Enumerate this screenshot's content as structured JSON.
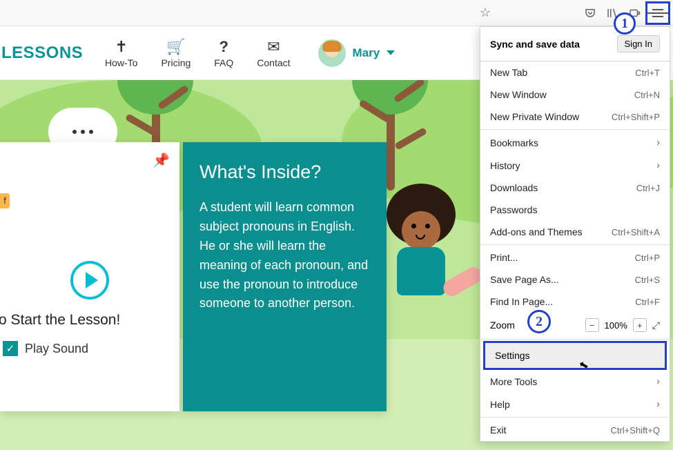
{
  "annotations": {
    "badge1": "1",
    "badge2": "2"
  },
  "nav": {
    "brand": "LESSONS",
    "items": [
      {
        "label": "How-To"
      },
      {
        "label": "Pricing"
      },
      {
        "label": "FAQ"
      },
      {
        "label": "Contact"
      }
    ],
    "user_name": "Mary"
  },
  "lesson": {
    "tag": "f",
    "start": "o Start the Lesson!",
    "sound": "Play Sound",
    "info_title": "What's Inside?",
    "info_text": "A student will learn common subject pronouns in English. He or she will learn the meaning of each pronoun, and use the pronoun to introduce someone to another person."
  },
  "menu": {
    "sync": "Sync and save data",
    "signin": "Sign In",
    "items1": [
      {
        "label": "New Tab",
        "hint": "Ctrl+T"
      },
      {
        "label": "New Window",
        "hint": "Ctrl+N"
      },
      {
        "label": "New Private Window",
        "hint": "Ctrl+Shift+P"
      }
    ],
    "items2": [
      {
        "label": "Bookmarks",
        "chev": true
      },
      {
        "label": "History",
        "chev": true
      },
      {
        "label": "Downloads",
        "hint": "Ctrl+J"
      },
      {
        "label": "Passwords"
      },
      {
        "label": "Add-ons and Themes",
        "hint": "Ctrl+Shift+A"
      }
    ],
    "items3": [
      {
        "label": "Print...",
        "hint": "Ctrl+P"
      },
      {
        "label": "Save Page As...",
        "hint": "Ctrl+S"
      },
      {
        "label": "Find In Page...",
        "hint": "Ctrl+F"
      }
    ],
    "zoom_label": "Zoom",
    "zoom_value": "100%",
    "settings": "Settings",
    "items4": [
      {
        "label": "More Tools",
        "chev": true
      },
      {
        "label": "Help",
        "chev": true
      }
    ],
    "exit": {
      "label": "Exit",
      "hint": "Ctrl+Shift+Q"
    }
  }
}
